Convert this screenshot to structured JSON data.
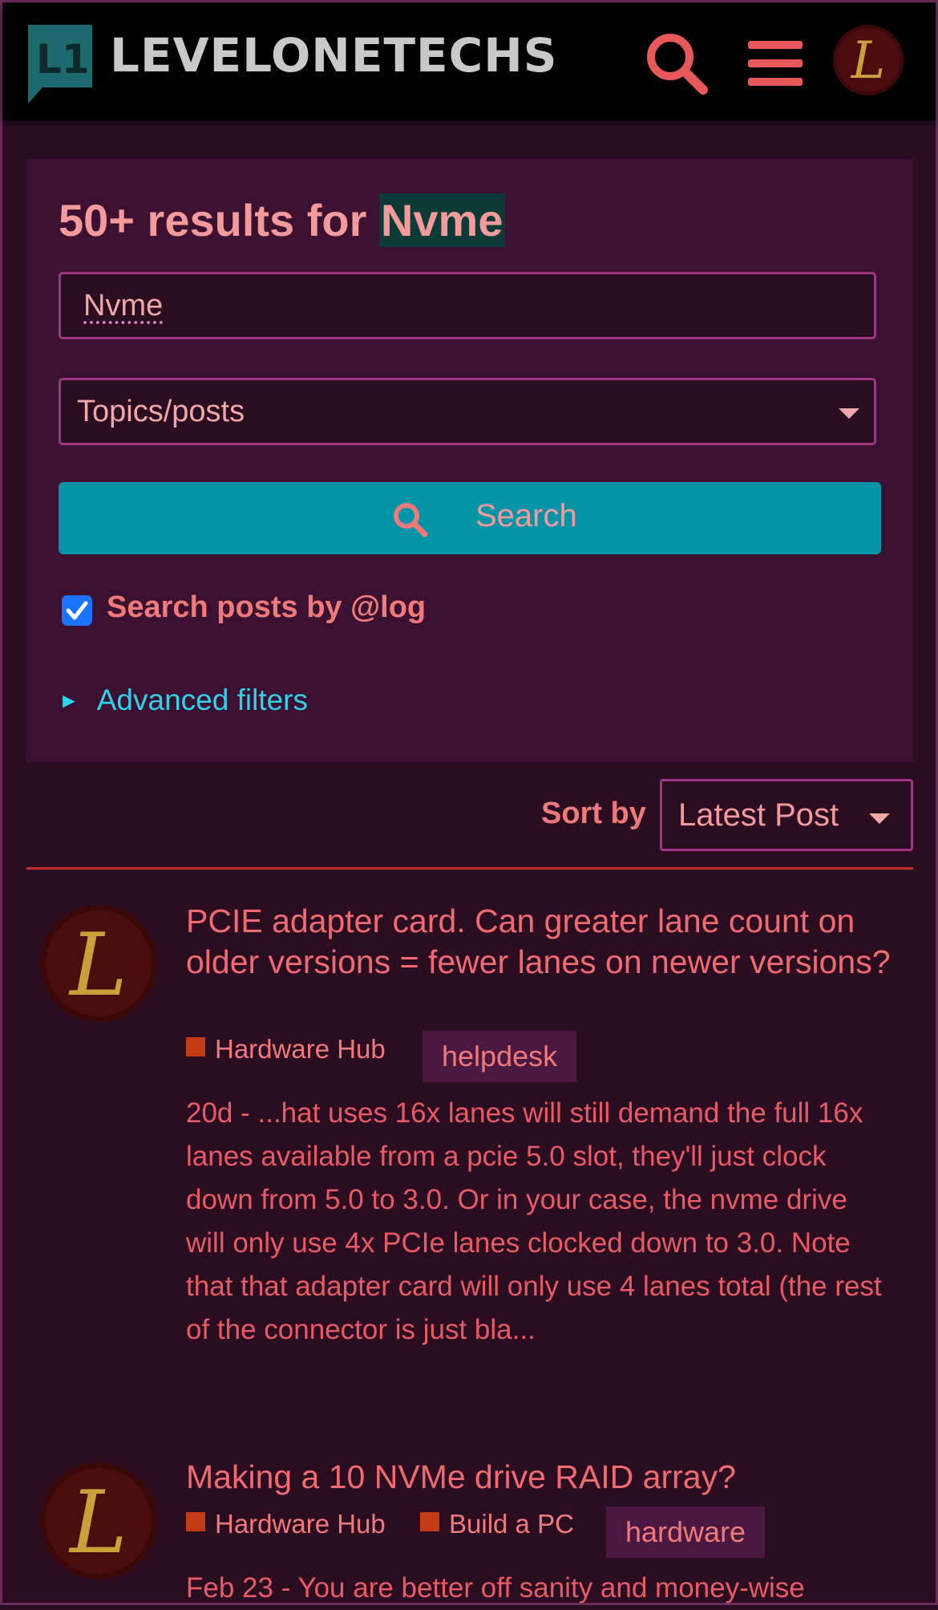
{
  "header": {
    "logo_text": "LEVELONETECHS",
    "logo_mark_text": "L1",
    "avatar_letter": "L"
  },
  "search": {
    "results_count_prefix": "50+ results for",
    "query_highlight": "Nvme",
    "input_value": "Nvme",
    "scope_selected": "Topics/posts",
    "search_button_label": "Search",
    "checkbox_label": "Search posts by @log",
    "checkbox_checked": true,
    "advanced_filters_label": "Advanced filters"
  },
  "sort": {
    "label": "Sort by",
    "selected": "Latest Post"
  },
  "results": [
    {
      "avatar_letter": "L",
      "title": "PCIE adapter card. Can greater lane count on older versions = fewer lanes on newer versions?",
      "categories": [
        "Hardware Hub"
      ],
      "tag": "helpdesk",
      "blurb": "20d - ...hat uses 16x lanes will still demand the full 16x lanes available from a pcie 5.0 slot, they'll just clock down from 5.0 to 3.0. Or in your case, the nvme drive will only use 4x PCIe lanes clocked down to 3.0. Note that that adapter card will only use 4 lanes total (the rest of the connector is just bla..."
    },
    {
      "avatar_letter": "L",
      "title": "Making a 10 NVMe drive RAID array?",
      "categories": [
        "Hardware Hub",
        "Build a PC"
      ],
      "tag": "hardware",
      "blurb": "Feb 23 - You are better off sanity and money-wise"
    }
  ],
  "colors": {
    "background": "#2b0d22",
    "panel": "#3b1030",
    "accent_button": "#0394a8",
    "text_salmon": "#e0606a",
    "link_cyan": "#2fd2e8",
    "divider": "#c42a2a",
    "category_square": "#c43a14"
  },
  "icons": [
    "logo-icon",
    "search-icon",
    "hamburger-menu-icon",
    "user-avatar",
    "dropdown-caret-icon",
    "checkmark-icon",
    "triangle-right-icon"
  ]
}
